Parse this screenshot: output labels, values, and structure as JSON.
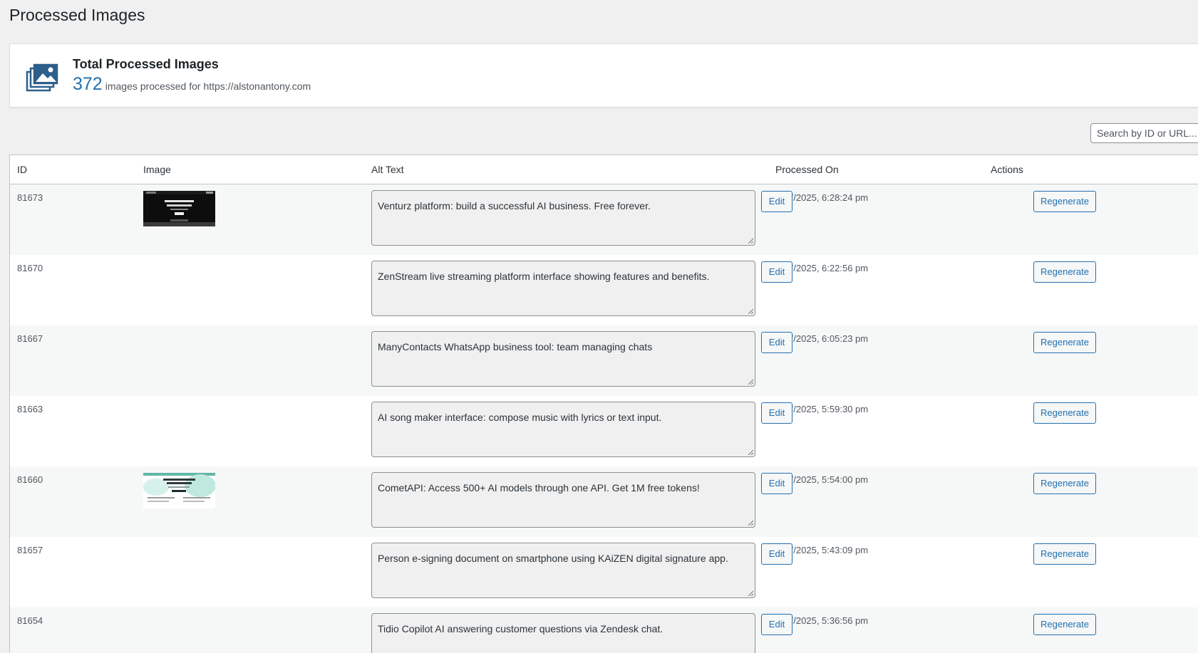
{
  "page": {
    "title": "Processed Images"
  },
  "summary": {
    "title": "Total Processed Images",
    "count": "372",
    "suffix": "images processed for https://alstonantony.com",
    "icon": "images-stack-icon",
    "accent": "#2271b1"
  },
  "search": {
    "placeholder": "Search by ID or URL...",
    "value": ""
  },
  "table": {
    "columns": {
      "id": "ID",
      "image": "Image",
      "alt_text": "Alt Text",
      "processed_on": "Processed On",
      "actions": "Actions"
    },
    "edit_label": "Edit",
    "regenerate_label": "Regenerate",
    "rows": [
      {
        "id": "81673",
        "has_image": true,
        "thumb": "dark",
        "alt": "Venturz platform: build a successful AI business.  Free forever.",
        "processed_on": "18/7/2025, 6:28:24 pm"
      },
      {
        "id": "81670",
        "has_image": false,
        "alt": "ZenStream live streaming platform interface showing features and benefits.",
        "processed_on": "18/7/2025, 6:22:56 pm"
      },
      {
        "id": "81667",
        "has_image": false,
        "alt": "ManyContacts WhatsApp business tool: team managing chats",
        "processed_on": "18/7/2025, 6:05:23 pm"
      },
      {
        "id": "81663",
        "has_image": false,
        "alt": "AI song maker interface: compose music with lyrics or text input.",
        "processed_on": "18/7/2025, 5:59:30 pm"
      },
      {
        "id": "81660",
        "has_image": true,
        "thumb": "light",
        "alt": "CometAPI: Access 500+ AI models through one API. Get 1M free tokens!",
        "processed_on": "18/7/2025, 5:54:00 pm"
      },
      {
        "id": "81657",
        "has_image": false,
        "alt": "Person e-signing document on smartphone using KAiZEN digital signature app.",
        "processed_on": "18/7/2025, 5:43:09 pm"
      },
      {
        "id": "81654",
        "has_image": false,
        "alt": "Tidio Copilot AI answering customer questions via Zendesk chat.",
        "processed_on": "18/7/2025, 5:36:56 pm"
      }
    ]
  }
}
